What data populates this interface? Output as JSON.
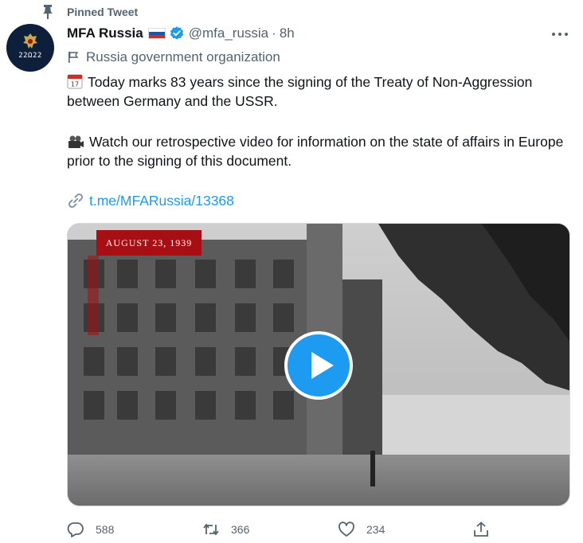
{
  "pinned": {
    "label": "Pinned Tweet"
  },
  "account": {
    "display_name": "MFA Russia",
    "handle": "@mfa_russia",
    "separator": "·",
    "time": "8h",
    "affiliation": "Russia government organization",
    "avatar_text": "22Ω22"
  },
  "tweet": {
    "line1": "Today marks 83 years since the signing of the Treaty of Non-Aggression between Germany and the USSR.",
    "line2": "Watch our retrospective video for information on the state of affairs in Europe prior to the signing of this document.",
    "link": "t.me/MFARussia/13368"
  },
  "video": {
    "date_caption": "AUGUST 23, 1939"
  },
  "actions": {
    "replies": "588",
    "retweets": "366",
    "likes": "234"
  },
  "colors": {
    "accent": "#1d9bf0",
    "muted": "#536471",
    "caption_red": "#a80f14"
  },
  "icons": [
    "pin-icon",
    "verified-icon",
    "more-icon",
    "flag-icon",
    "calendar-icon",
    "video-camera-icon",
    "link-icon",
    "play-icon",
    "reply-icon",
    "retweet-icon",
    "like-icon",
    "share-icon"
  ]
}
